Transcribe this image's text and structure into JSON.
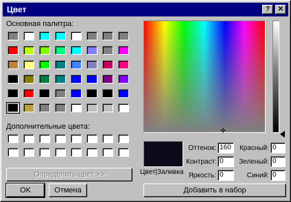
{
  "window": {
    "title": "Цвет",
    "help_label": "?",
    "close_label": "✕"
  },
  "basic_colors": {
    "label": "Основная палитра:",
    "rows": [
      [
        "#808080",
        "#ffffff",
        "#00ffff",
        "#00ffff",
        "#ffffff",
        "#808080",
        "#808080",
        "#808080"
      ],
      [
        "#ff0000",
        "#c0ff00",
        "#80ff00",
        "#00ff80",
        "#00ffff",
        "#8080ff",
        "#808080",
        "#ff00ff"
      ],
      [
        "#c08040",
        "#ffff80",
        "#00ff00",
        "#008080",
        "#4080ff",
        "#8080c0",
        "#c00060",
        "#ff0080"
      ],
      [
        "#000000",
        "#808000",
        "#008040",
        "#008080",
        "#0000ff",
        "#0000ff",
        "#800080",
        "#8000ff"
      ],
      [
        "#000000",
        "#ff0000",
        "#000000",
        "#808080",
        "#0000ff",
        "#000000",
        "#000000",
        "#0000ff"
      ],
      [
        "#000000",
        "#c0a040",
        "#808080",
        "#808080",
        "#ffffff",
        "#c0c0c0",
        "#c0c0c0",
        "#ffffff"
      ]
    ]
  },
  "custom_colors": {
    "label": "Дополнительные цвета:",
    "colors": [
      "#ffffff",
      "#ffffff",
      "#ffffff",
      "#ffffff",
      "#ffffff",
      "#ffffff",
      "#ffffff",
      "#ffffff",
      "#ffffff",
      "#ffffff",
      "#ffffff",
      "#ffffff",
      "#ffffff",
      "#ffffff",
      "#ffffff",
      "#ffffff"
    ]
  },
  "buttons": {
    "define_custom": "Определить цвет >>",
    "ok": "OK",
    "cancel": "Отмена",
    "add_to_custom": "Добавить в набор"
  },
  "preview": {
    "label": "Цвет|Заливка",
    "color": "#0a0a1a"
  },
  "fields": {
    "hue_label": "Оттенок:",
    "hue": "160",
    "sat_label": "Контраст:",
    "sat": "0",
    "lum_label": "Яркость:",
    "lum": "0",
    "red_label": "Красный:",
    "red": "0",
    "green_label": "Зеленый:",
    "green": "0",
    "blue_label": "Синий:",
    "blue": "0"
  }
}
